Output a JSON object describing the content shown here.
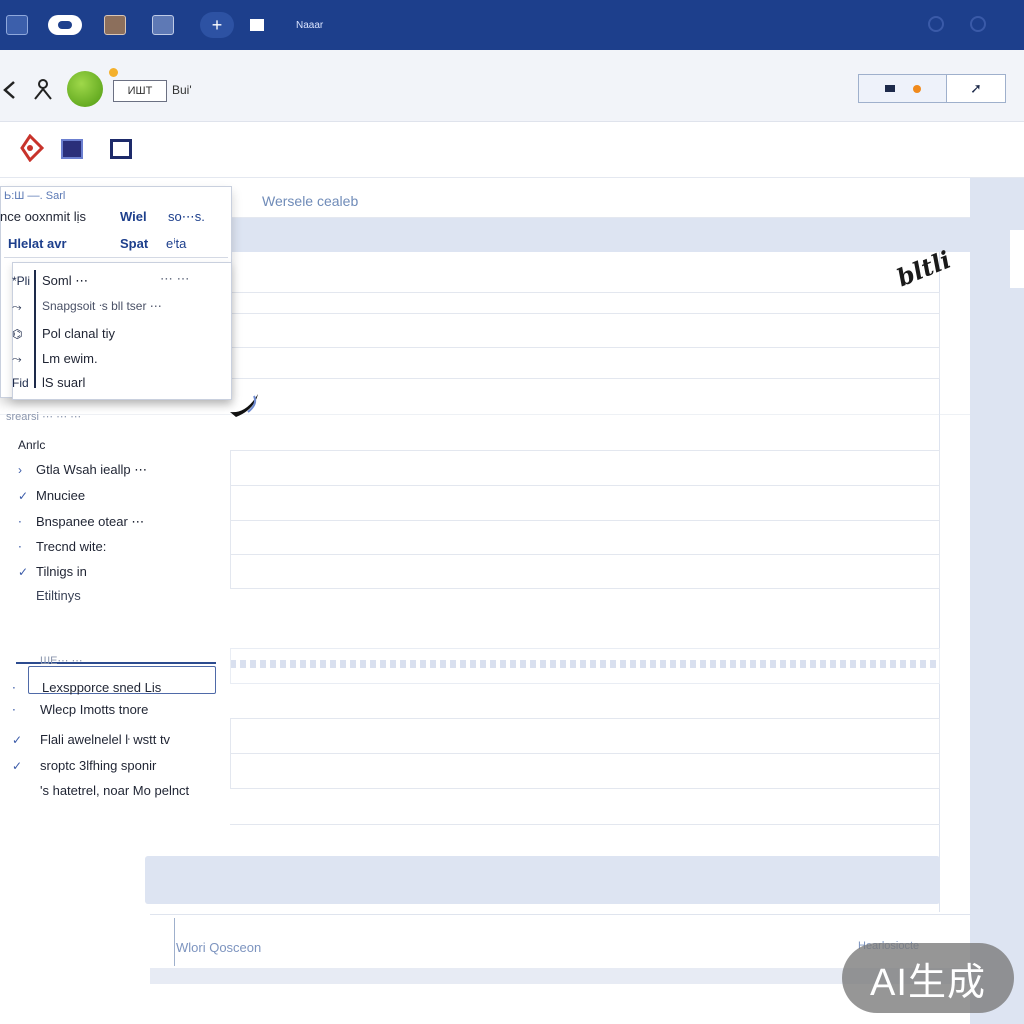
{
  "titlebar": {
    "title": "Naaar",
    "buttons": [
      "window-icon",
      "cloud-icon",
      "document-icon",
      "image-icon",
      "plus-icon",
      "square-icon"
    ],
    "colors": {
      "bg": "#1d3f8c",
      "accent": "#f08a1c"
    }
  },
  "toolbar": {
    "nav_chip": "ИШТ",
    "nav_label": "Bui'",
    "segment": {
      "left_icon": "card-icon",
      "right_icon": "arrow-icon"
    }
  },
  "iconrow": [
    "diamond-icon",
    "panel-icon",
    "box-icon"
  ],
  "tabstrip": {
    "label": "Wersele cealeb"
  },
  "popup": {
    "title": "Ь:Ш ––. Sarl",
    "header_rows": [
      {
        "left": "nce ooxnmit lịs",
        "right": "Wiel",
        "right2": "so⋯s."
      },
      {
        "left": "Hlelat avr",
        "right": "Spat",
        "right2": "eⁱta"
      }
    ],
    "items": [
      {
        "glyph": "*Pli",
        "label": "Soml ⋯",
        "trail": "⋯ ⋯"
      },
      {
        "glyph": "⤳",
        "label": "Snapgsoit ᐧs bll tser ⋯"
      },
      {
        "glyph": "⌬",
        "label": "Pol clanal tiy"
      },
      {
        "glyph": "⤳",
        "label": "Lm ewim."
      },
      {
        "glyph": "Fid",
        "label": "lS suarl"
      }
    ]
  },
  "sidebar": {
    "faint_header": "srearsi ⋯ ⋯ ⋯",
    "section1_title": "Anrlc",
    "section1_items": [
      {
        "mark": "›",
        "label": "Gtla Wsah ieallp ⋯"
      },
      {
        "mark": "✓",
        "label": "Mnuciee"
      },
      {
        "mark": "⋅",
        "label": "Bnspanee otear ⋯"
      },
      {
        "mark": "⋅",
        "label": "Trecnd wite:"
      },
      {
        "mark": "✓",
        "label": "Tilnigs in"
      },
      {
        "mark": "",
        "label": "Etiltinys"
      }
    ],
    "section2_faint": "ШЕ⋯ ⋯",
    "section2_items": [
      {
        "mark": "⋅",
        "label": "Lexspporce sned Lis"
      },
      {
        "mark": "⋅",
        "label": "Wlecp Imotts tnore"
      },
      {
        "mark": "✓",
        "label": "Flali awelnelel ŀ wstt tv"
      },
      {
        "mark": "✓",
        "label": "sroptc 3lfhing sponir"
      },
      {
        "mark": "",
        "label": "'s hatetrel, noar Mo pelnct"
      }
    ]
  },
  "canvas": {
    "signature": "bltli"
  },
  "footer": {
    "left": "Wlori Qosceon",
    "right": "Hearlosiocte"
  },
  "watermark": "AI生成"
}
